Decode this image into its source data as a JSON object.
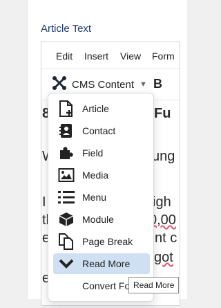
{
  "field_label": "Article Text",
  "menubar": [
    "Edit",
    "Insert",
    "View",
    "Form"
  ],
  "toolbar": {
    "cms_label": "CMS Content",
    "bold": "B"
  },
  "content_lines": [
    "8",
    "Fu",
    "W",
    "ung",
    "I",
    "igh",
    "th",
    "0,00",
    "e",
    "nt c",
    "got",
    "e"
  ],
  "dropdown_items": [
    {
      "label": "Article",
      "icon": "document-plus-icon"
    },
    {
      "label": "Contact",
      "icon": "contact-card-icon"
    },
    {
      "label": "Field",
      "icon": "puzzle-icon"
    },
    {
      "label": "Media",
      "icon": "image-icon"
    },
    {
      "label": "Menu",
      "icon": "list-icon"
    },
    {
      "label": "Module",
      "icon": "cube-icon"
    },
    {
      "label": "Page Break",
      "icon": "copy-pages-icon"
    },
    {
      "label": "Read More",
      "icon": "chevron-down-icon",
      "active": true
    },
    {
      "label": "Convert Fo",
      "icon": ""
    }
  ],
  "tooltip": "Read More"
}
